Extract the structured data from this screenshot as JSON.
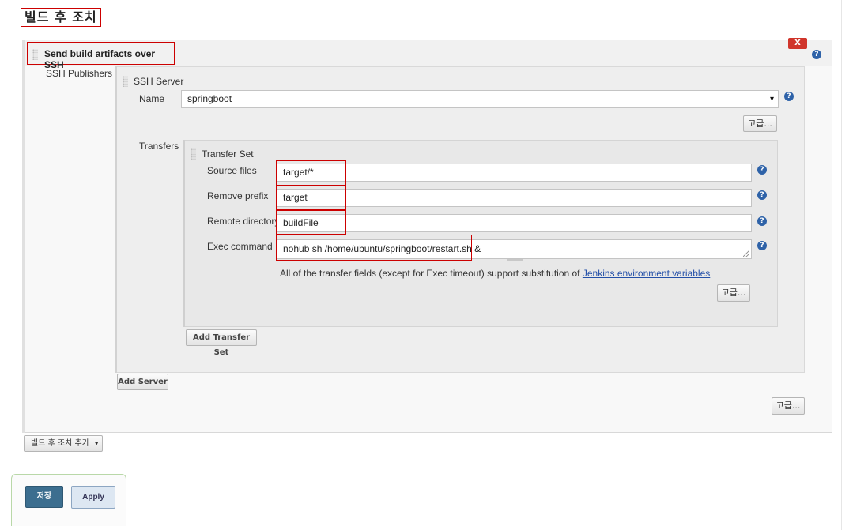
{
  "section": {
    "title": "빌드 후 조치"
  },
  "publisher": {
    "title": "Send build artifacts over SSH",
    "delete_label": "X",
    "ssh_publishers_label": "SSH Publishers",
    "add_server_label": "Add Server",
    "advanced_label": "고급..."
  },
  "ssh_server": {
    "title": "SSH Server",
    "name_label": "Name",
    "name_value": "springboot",
    "advanced_label": "고급...",
    "transfers_label": "Transfers"
  },
  "transfer_set": {
    "title": "Transfer Set",
    "fields": [
      {
        "label": "Source files",
        "value": "target/*"
      },
      {
        "label": "Remove prefix",
        "value": "target"
      },
      {
        "label": "Remote directory",
        "value": "buildFile"
      },
      {
        "label": "Exec command",
        "value": "nohub sh /home/ubuntu/springboot/restart.sh &"
      }
    ],
    "note_prefix": "All of the transfer fields (except for Exec timeout) support substitution of ",
    "note_link": "Jenkins environment variables",
    "advanced_label": "고급...",
    "add_transfer_set_label": "Add Transfer Set"
  },
  "footer": {
    "add_post_build_label": "빌드 후 조치 추가",
    "save_label": "저장",
    "apply_label": "Apply"
  },
  "help_glyph": "?",
  "dropdown_glyph": "▾",
  "icons": [
    "drag-grip-icon",
    "help-icon",
    "dropdown-arrow-icon",
    "resize-grip-icon"
  ],
  "colors": {
    "delete": "#d0352b",
    "save": "#3c6e8f",
    "help": "#2e62a8",
    "highlight": "#cc0000",
    "link": "#2450a8"
  }
}
